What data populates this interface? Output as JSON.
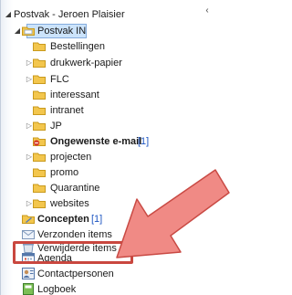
{
  "account": {
    "label": "Postvak - Jeroen Plaisier"
  },
  "folders": [
    {
      "label": "Postvak IN",
      "count": "",
      "bold": false,
      "icon": "inbox-folder-icon"
    },
    {
      "label": "Bestellingen",
      "count": "",
      "bold": false,
      "icon": "folder-icon"
    },
    {
      "label": "drukwerk-papier",
      "count": "",
      "bold": false,
      "icon": "folder-icon"
    },
    {
      "label": "FLC",
      "count": "",
      "bold": false,
      "icon": "folder-icon"
    },
    {
      "label": "interessant",
      "count": "",
      "bold": false,
      "icon": "folder-icon"
    },
    {
      "label": "intranet",
      "count": "",
      "bold": false,
      "icon": "folder-icon"
    },
    {
      "label": "JP",
      "count": "",
      "bold": false,
      "icon": "folder-icon"
    },
    {
      "label": "Ongewenste e-mail",
      "count": "[1]",
      "bold": true,
      "icon": "junk-mail-folder-icon"
    },
    {
      "label": "projecten",
      "count": "",
      "bold": false,
      "icon": "folder-icon"
    },
    {
      "label": "promo",
      "count": "",
      "bold": false,
      "icon": "folder-icon"
    },
    {
      "label": "Quarantine",
      "count": "",
      "bold": false,
      "icon": "folder-icon"
    },
    {
      "label": "websites",
      "count": "",
      "bold": false,
      "icon": "folder-icon"
    },
    {
      "label": "Concepten",
      "count": "[1]",
      "bold": true,
      "icon": "drafts-folder-icon"
    },
    {
      "label": "Verzonden items",
      "count": "",
      "bold": false,
      "icon": "sent-items-icon"
    },
    {
      "label": "Verwijderde items",
      "count": "",
      "bold": false,
      "icon": "deleted-items-icon"
    }
  ],
  "modules": [
    {
      "label": "Agenda",
      "icon": "calendar-icon"
    },
    {
      "label": "Contactpersonen",
      "icon": "contacts-icon"
    },
    {
      "label": "Logboek",
      "icon": "journal-icon"
    }
  ],
  "colors": {
    "selection": "#cbe3fb",
    "highlight": "#c9473f",
    "arrow": "#f08a85",
    "folder": "#f3c64d"
  }
}
